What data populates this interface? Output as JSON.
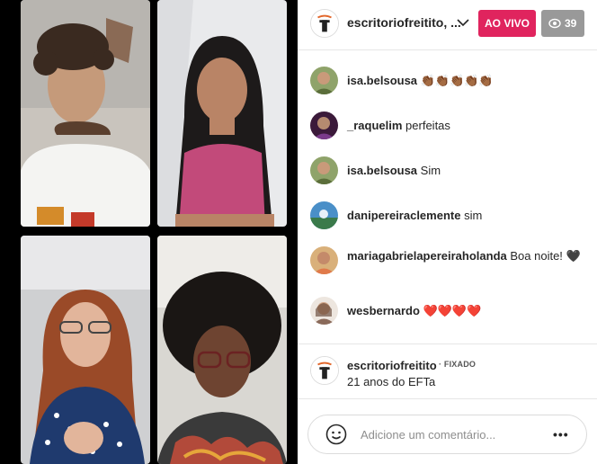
{
  "header": {
    "username": "escritoriofreitito, ...",
    "live_label": "AO VIVO",
    "viewer_count": "39",
    "chevron_icon": "chevron-down-icon",
    "eye_icon": "eye-icon",
    "live_color": "#e0245e"
  },
  "comments": [
    {
      "user": "isa.belsousa",
      "text": "👏🏾👏🏾👏🏾👏🏾👏🏾"
    },
    {
      "user": "_raquelim",
      "text": "perfeitas"
    },
    {
      "user": "isa.belsousa",
      "text": "Sim"
    },
    {
      "user": "danipereiraclemente",
      "text": "sim"
    },
    {
      "user": "mariagabrielapereiraholanda",
      "text": "Boa noite! 🖤"
    },
    {
      "user": "wesbernardo",
      "text": "❤️❤️❤️❤️"
    }
  ],
  "pinned": {
    "user": "escritoriofreitito",
    "badge": "· FIXADO",
    "text": "21 anos do EFTa"
  },
  "comment_box": {
    "placeholder": "Adicione um comentário...",
    "more_label": "•••",
    "emoji_icon": "smile-icon"
  }
}
